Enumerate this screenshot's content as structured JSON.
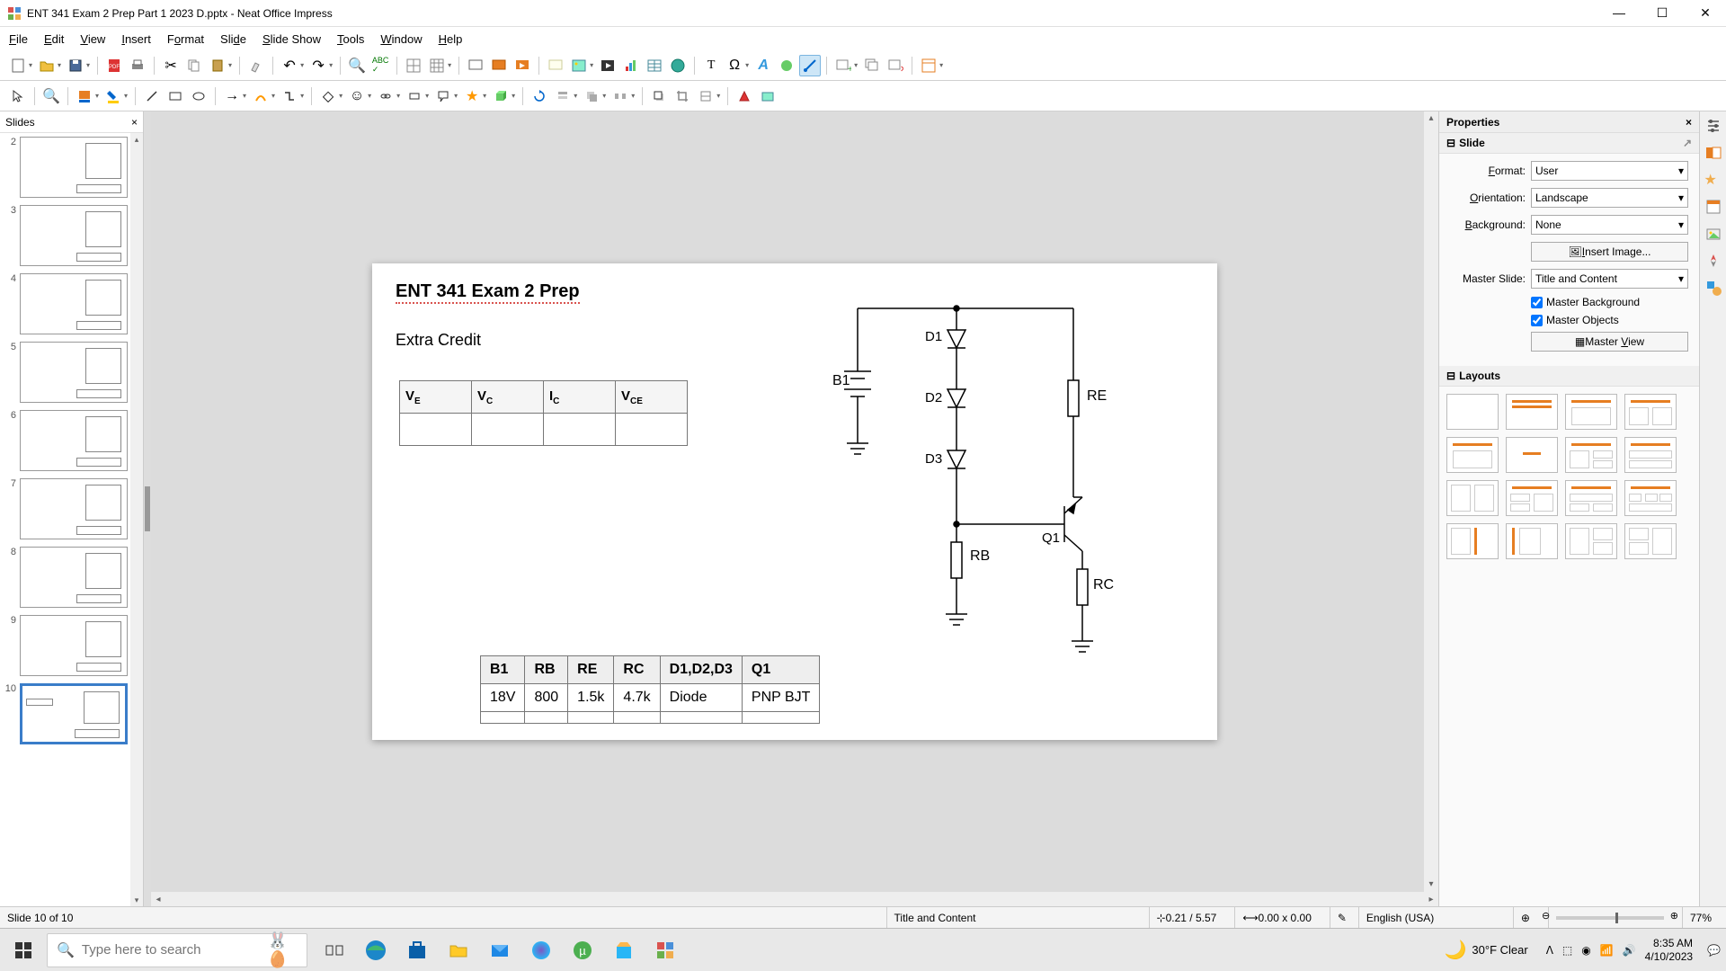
{
  "window": {
    "title": "ENT 341 Exam 2 Prep Part 1 2023 D.pptx - Neat Office Impress"
  },
  "menu": {
    "items": [
      "File",
      "Edit",
      "View",
      "Insert",
      "Format",
      "Slide",
      "Slide Show",
      "Tools",
      "Window",
      "Help"
    ]
  },
  "slides_panel": {
    "header": "Slides",
    "visible_numbers": [
      "2",
      "3",
      "4",
      "5",
      "6",
      "7",
      "8",
      "9",
      "10"
    ],
    "selected": "10"
  },
  "slide": {
    "title": "ENT 341 Exam 2 Prep",
    "subtitle": "Extra Credit",
    "table1_headers": [
      "V_E",
      "V_C",
      "I_C",
      "V_CE"
    ],
    "table2_headers": [
      "B1",
      "RB",
      "RE",
      "RC",
      "D1,D2,D3",
      "Q1"
    ],
    "table2_values": [
      "18V",
      "800",
      "1.5k",
      "4.7k",
      "Diode",
      "PNP BJT"
    ],
    "circuit": {
      "D1": "D1",
      "D2": "D2",
      "D3": "D3",
      "B1": "B1",
      "RE": "RE",
      "RB": "RB",
      "RC": "RC",
      "Q1": "Q1"
    }
  },
  "properties": {
    "title": "Properties",
    "slide_section": "Slide",
    "format_label": "Format:",
    "format_value": "User",
    "orientation_label": "Orientation:",
    "orientation_value": "Landscape",
    "background_label": "Background:",
    "background_value": "None",
    "insert_image": "Insert Image...",
    "master_slide_label": "Master Slide:",
    "master_slide_value": "Title and Content",
    "master_background": "Master Background",
    "master_objects": "Master Objects",
    "master_view": "Master View",
    "layouts_section": "Layouts"
  },
  "status": {
    "slide_count": "Slide 10 of 10",
    "layout": "Title and Content",
    "coords": "0.21 / 5.57",
    "size": "0.00 x 0.00",
    "language": "English (USA)",
    "zoom": "77%"
  },
  "taskbar": {
    "search_placeholder": "Type here to search",
    "weather": "30°F Clear",
    "time": "8:35 AM",
    "date": "4/10/2023"
  }
}
